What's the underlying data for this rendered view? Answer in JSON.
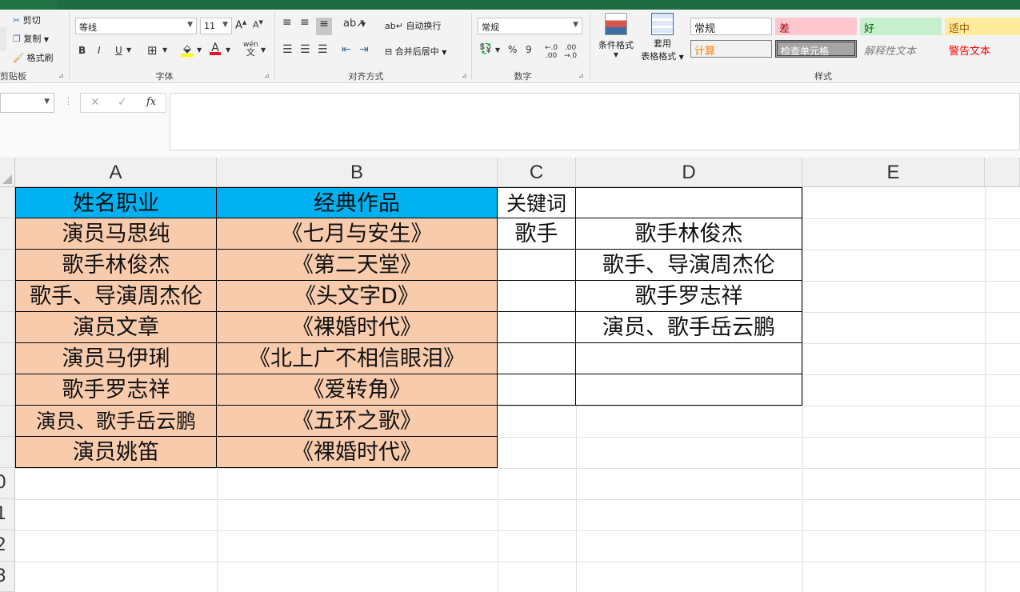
{
  "ribbon": {
    "clipboard": {
      "cut": "剪切",
      "copy": "复制",
      "format_painter": "格式刷",
      "label": "剪贴板"
    },
    "font": {
      "name": "等线",
      "size": "11",
      "bold": "B",
      "italic": "I",
      "underline": "U",
      "label": "字体"
    },
    "alignment": {
      "wrap_text": "自动换行",
      "merge_center": "合并后居中",
      "label": "对齐方式"
    },
    "number": {
      "format": "常规",
      "percent": "%",
      "comma": "9",
      "label": "数字"
    },
    "styles": {
      "conditional_format": "条件格式",
      "table_format_1": "套用",
      "table_format_2": "表格格式",
      "label": "样式",
      "normal": "常规",
      "bad": "差",
      "good": "好",
      "neutral": "适中",
      "calculation": "计算",
      "check_cell": "检查单元格",
      "explanatory": "解释性文本",
      "warning": "警告文本"
    }
  },
  "formula_bar": {
    "cancel": "✕",
    "enter": "✓",
    "fx": "fx",
    "value": ""
  },
  "columns": [
    "A",
    "B",
    "C",
    "D",
    "E"
  ],
  "rows_partial": [
    "0",
    "1",
    "2",
    "3"
  ],
  "sheet": {
    "A": [
      "姓名职业",
      "演员马思纯",
      "歌手林俊杰",
      "歌手、导演周杰伦",
      "演员文章",
      "演员马伊琍",
      "歌手罗志祥",
      "演员、歌手岳云鹏",
      "演员姚笛"
    ],
    "B": [
      "经典作品",
      "《七月与安生》",
      "《第二天堂》",
      "《头文字D》",
      "《裸婚时代》",
      "《北上广不相信眼泪》",
      "《爱转角》",
      "《五环之歌》",
      "《裸婚时代》"
    ],
    "C": [
      "关键词",
      "歌手"
    ],
    "D": [
      "",
      "歌手林俊杰",
      "歌手、导演周杰伦",
      "歌手罗志祥",
      "演员、歌手岳云鹏"
    ]
  },
  "colors": {
    "header_fill": "#00b0f0",
    "data_fill": "#f8cbad",
    "excel_green": "#217346"
  }
}
